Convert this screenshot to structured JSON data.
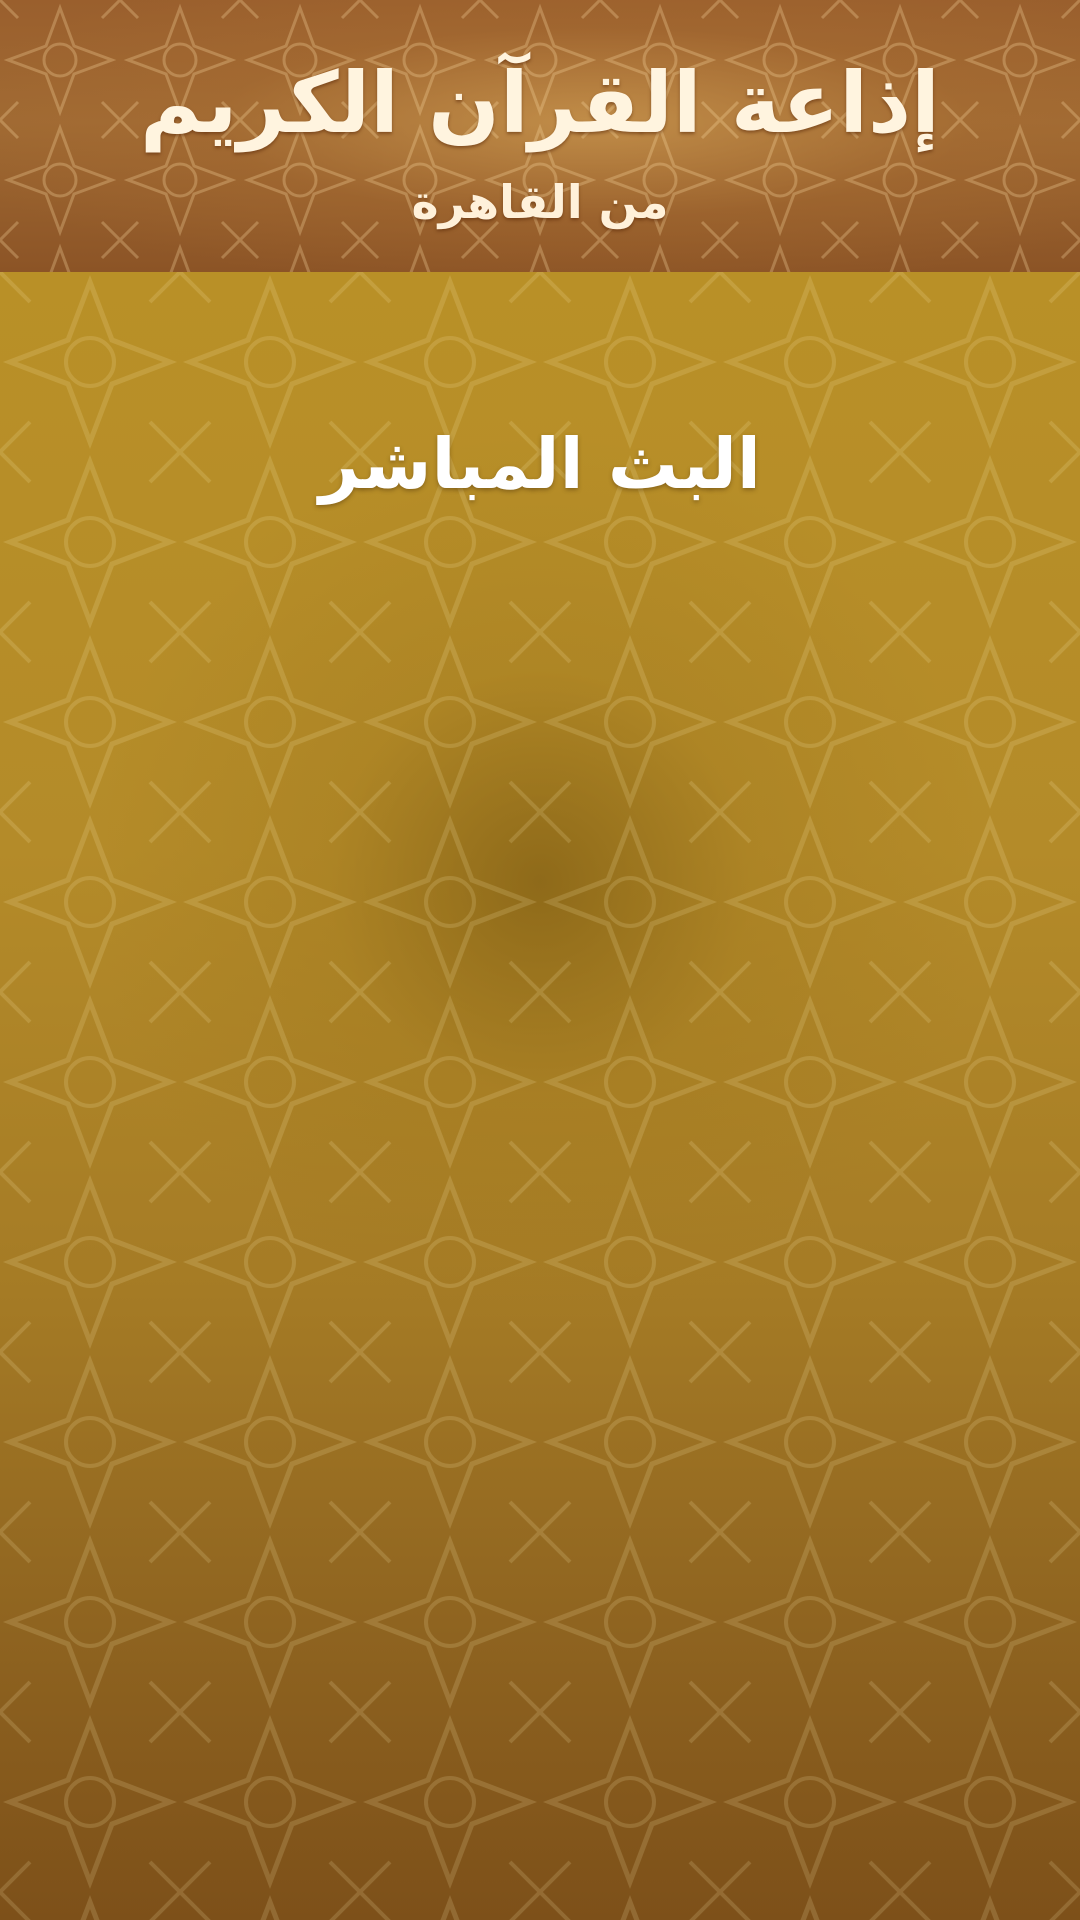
{
  "header": {
    "title": "إذاعة القرآن الكريم",
    "subtitle": "من القاهرة"
  },
  "main": {
    "live_label": "البث المباشر"
  },
  "colors": {
    "header_brown": "#9a5f2d",
    "main_gold": "#b99027",
    "text_cream": "#fff4df",
    "text_white": "#ffffff"
  }
}
